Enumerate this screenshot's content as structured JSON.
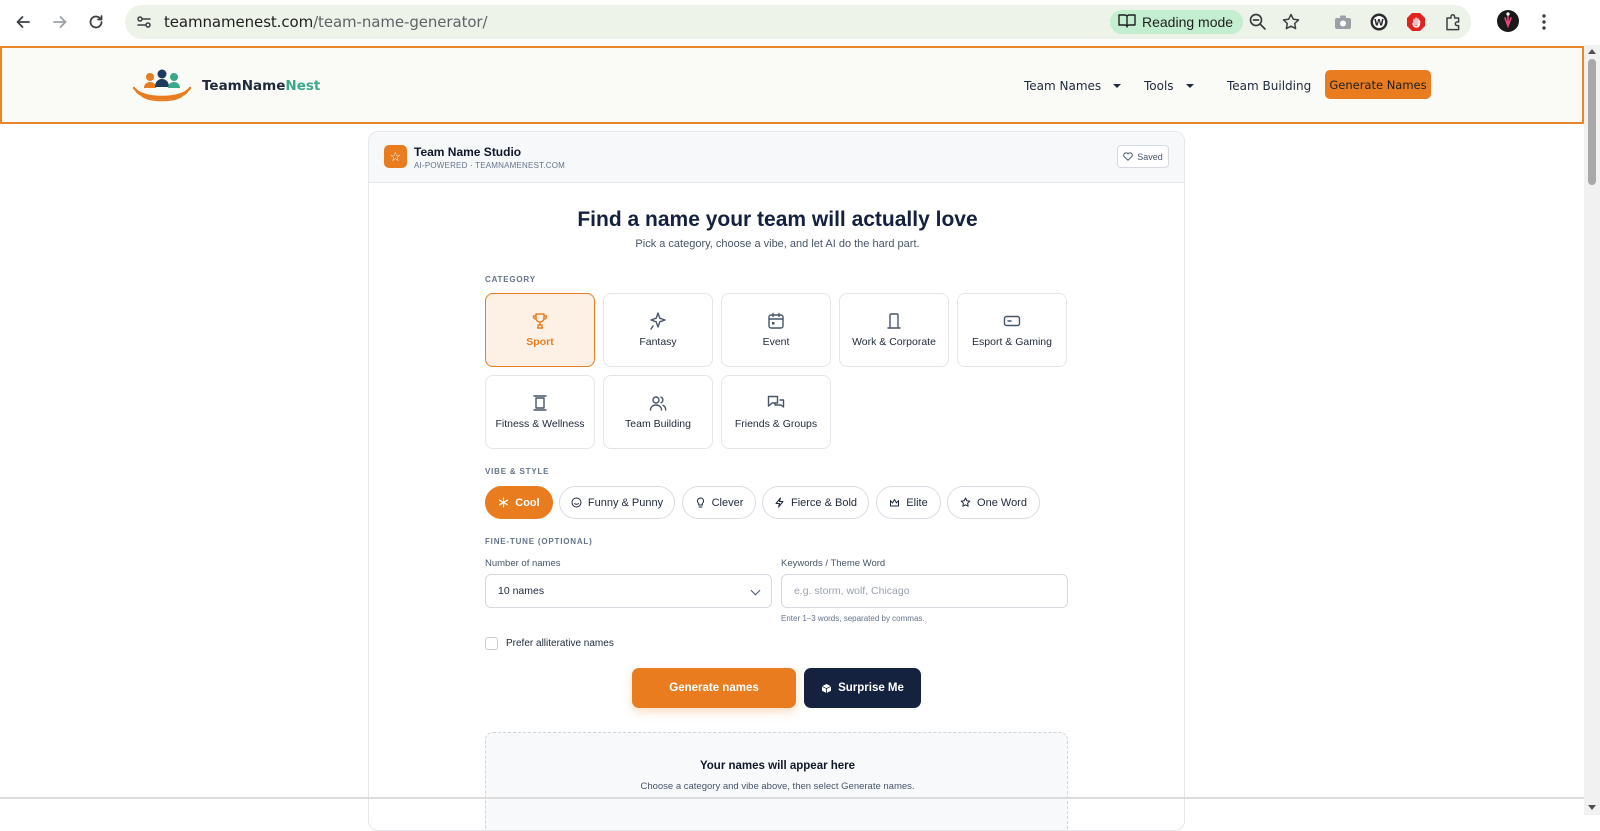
{
  "browser": {
    "url_host": "teamnamenest.com",
    "url_path": "/team-name-generator/",
    "reading_mode_label": "Reading mode"
  },
  "header": {
    "brand_main": "TeamName",
    "brand_accent": "Nest",
    "nav": [
      {
        "label": "Team Names"
      },
      {
        "label": "Tools"
      },
      {
        "label": "Team Building"
      }
    ],
    "cta_label": "Generate Names"
  },
  "studio": {
    "title": "Team Name Studio",
    "subtitle": "AI-POWERED · TEAMNAMENEST.COM",
    "saved_label": "Saved"
  },
  "hero": {
    "headline": "Find a name your team will actually love",
    "subline": "Pick a category, choose a vibe, and let AI do the hard part."
  },
  "category": {
    "label": "CATEGORY",
    "items": [
      {
        "label": "Sport",
        "icon": "trophy-icon",
        "active": true
      },
      {
        "label": "Fantasy",
        "icon": "sparkle-icon"
      },
      {
        "label": "Event",
        "icon": "calendar-icon"
      },
      {
        "label": "Work & Corporate",
        "icon": "building-icon"
      },
      {
        "label": "Esport & Gaming",
        "icon": "gamepad-icon"
      },
      {
        "label": "Fitness & Wellness",
        "icon": "dumbbell-icon"
      },
      {
        "label": "Team Building",
        "icon": "users-icon"
      },
      {
        "label": "Friends & Groups",
        "icon": "chat-icon"
      }
    ]
  },
  "vibe": {
    "label": "VIBE & STYLE",
    "items": [
      {
        "label": "Cool",
        "icon": "snowflake-icon",
        "active": true
      },
      {
        "label": "Funny & Punny",
        "icon": "smile-icon"
      },
      {
        "label": "Clever",
        "icon": "lightbulb-icon"
      },
      {
        "label": "Fierce & Bold",
        "icon": "bolt-icon"
      },
      {
        "label": "Elite",
        "icon": "crown-icon"
      },
      {
        "label": "One Word",
        "icon": "star-icon"
      }
    ]
  },
  "finetune": {
    "label": "FINE-TUNE (OPTIONAL)",
    "count_label": "Number of names",
    "count_value": "10 names",
    "keywords_label": "Keywords / Theme Word",
    "keywords_placeholder": "e.g. storm, wolf, Chicago",
    "keywords_hint": "Enter 1–3 words, separated by commas.",
    "alliterative_label": "Prefer alliterative names"
  },
  "actions": {
    "generate_label": "Generate names",
    "surprise_label": "Surprise Me"
  },
  "results": {
    "title": "Your names will appear here",
    "subtitle": "Choose a category and vibe above, then select Generate names."
  },
  "colors": {
    "accent": "#e87c1e",
    "navy": "#14213f",
    "brand_teal": "#3aa98a"
  }
}
